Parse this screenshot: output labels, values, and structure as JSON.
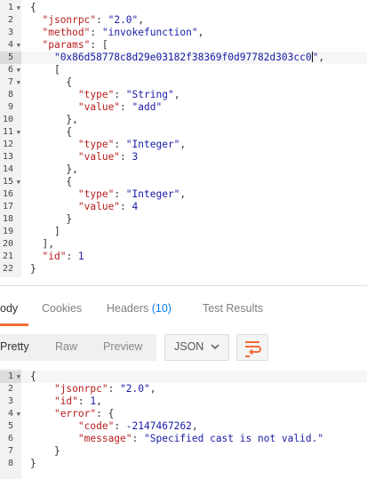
{
  "request_editor": {
    "lines": [
      {
        "n": "1",
        "fold": true,
        "html": "<span class=\"p\">{</span>"
      },
      {
        "n": "2",
        "html": "  <span class=\"k\">\"jsonrpc\"</span><span class=\"p\">: </span><span class=\"s\">\"2.0\"</span><span class=\"p\">,</span>"
      },
      {
        "n": "3",
        "html": "  <span class=\"k\">\"method\"</span><span class=\"p\">: </span><span class=\"s\">\"invokefunction\"</span><span class=\"p\">,</span>"
      },
      {
        "n": "4",
        "fold": true,
        "html": "  <span class=\"k\">\"params\"</span><span class=\"p\">: [</span>"
      },
      {
        "n": "5",
        "active": true,
        "html": "    <span class=\"s\">\"0x86d58778c8d29e03182f38369f0d97782d303cc0</span><span class=\"cursor\"></span><span class=\"s\">\"</span><span class=\"p\">,</span>"
      },
      {
        "n": "6",
        "fold": true,
        "html": "    <span class=\"p\">[</span>"
      },
      {
        "n": "7",
        "fold": true,
        "html": "      <span class=\"p\">{</span>"
      },
      {
        "n": "8",
        "html": "        <span class=\"k\">\"type\"</span><span class=\"p\">: </span><span class=\"s\">\"String\"</span><span class=\"p\">,</span>"
      },
      {
        "n": "9",
        "html": "        <span class=\"k\">\"value\"</span><span class=\"p\">: </span><span class=\"s\">\"add\"</span>"
      },
      {
        "n": "10",
        "html": "      <span class=\"p\">},</span>"
      },
      {
        "n": "11",
        "fold": true,
        "html": "      <span class=\"p\">{</span>"
      },
      {
        "n": "12",
        "html": "        <span class=\"k\">\"type\"</span><span class=\"p\">: </span><span class=\"s\">\"Integer\"</span><span class=\"p\">,</span>"
      },
      {
        "n": "13",
        "html": "        <span class=\"k\">\"value\"</span><span class=\"p\">: </span><span class=\"n\">3</span>"
      },
      {
        "n": "14",
        "html": "      <span class=\"p\">},</span>"
      },
      {
        "n": "15",
        "fold": true,
        "html": "      <span class=\"p\">{</span>"
      },
      {
        "n": "16",
        "html": "        <span class=\"k\">\"type\"</span><span class=\"p\">: </span><span class=\"s\">\"Integer\"</span><span class=\"p\">,</span>"
      },
      {
        "n": "17",
        "html": "        <span class=\"k\">\"value\"</span><span class=\"p\">: </span><span class=\"n\">4</span>"
      },
      {
        "n": "18",
        "html": "      <span class=\"p\">}</span>"
      },
      {
        "n": "19",
        "html": "    <span class=\"p\">]</span>"
      },
      {
        "n": "20",
        "html": "  <span class=\"p\">],</span>"
      },
      {
        "n": "21",
        "html": "  <span class=\"k\">\"id\"</span><span class=\"p\">: </span><span class=\"n\">1</span>"
      },
      {
        "n": "22",
        "html": "<span class=\"p\">}</span>"
      }
    ]
  },
  "tabs": {
    "body": "ody",
    "cookies": "Cookies",
    "headers": "Headers",
    "headers_count": "(10)",
    "test_results": "Test Results"
  },
  "toolbar": {
    "pretty": "Pretty",
    "raw": "Raw",
    "preview": "Preview",
    "format": "JSON",
    "wrap_icon": "wrap-lines-icon"
  },
  "response_editor": {
    "lines": [
      {
        "n": "1",
        "fold": true,
        "active": true,
        "html": "<span class=\"p\">{</span>"
      },
      {
        "n": "2",
        "html": "    <span class=\"k\">\"jsonrpc\"</span><span class=\"p\">: </span><span class=\"s\">\"2.0\"</span><span class=\"p\">,</span>"
      },
      {
        "n": "3",
        "html": "    <span class=\"k\">\"id\"</span><span class=\"p\">: </span><span class=\"n\">1</span><span class=\"p\">,</span>"
      },
      {
        "n": "4",
        "fold": true,
        "html": "    <span class=\"k\">\"error\"</span><span class=\"p\">: {</span>"
      },
      {
        "n": "5",
        "html": "        <span class=\"k\">\"code\"</span><span class=\"p\">: </span><span class=\"n\">-2147467262</span><span class=\"p\">,</span>"
      },
      {
        "n": "6",
        "html": "        <span class=\"k\">\"message\"</span><span class=\"p\">: </span><span class=\"s\">\"Specified cast is not valid.\"</span>"
      },
      {
        "n": "7",
        "html": "    <span class=\"p\">}</span>"
      },
      {
        "n": "8",
        "html": "<span class=\"p\">}</span>"
      }
    ]
  },
  "colors": {
    "accent": "#f26b3a",
    "count_blue": "#097bed",
    "key_red": "#b71c1c",
    "string_blue": "#1a1aa6"
  }
}
